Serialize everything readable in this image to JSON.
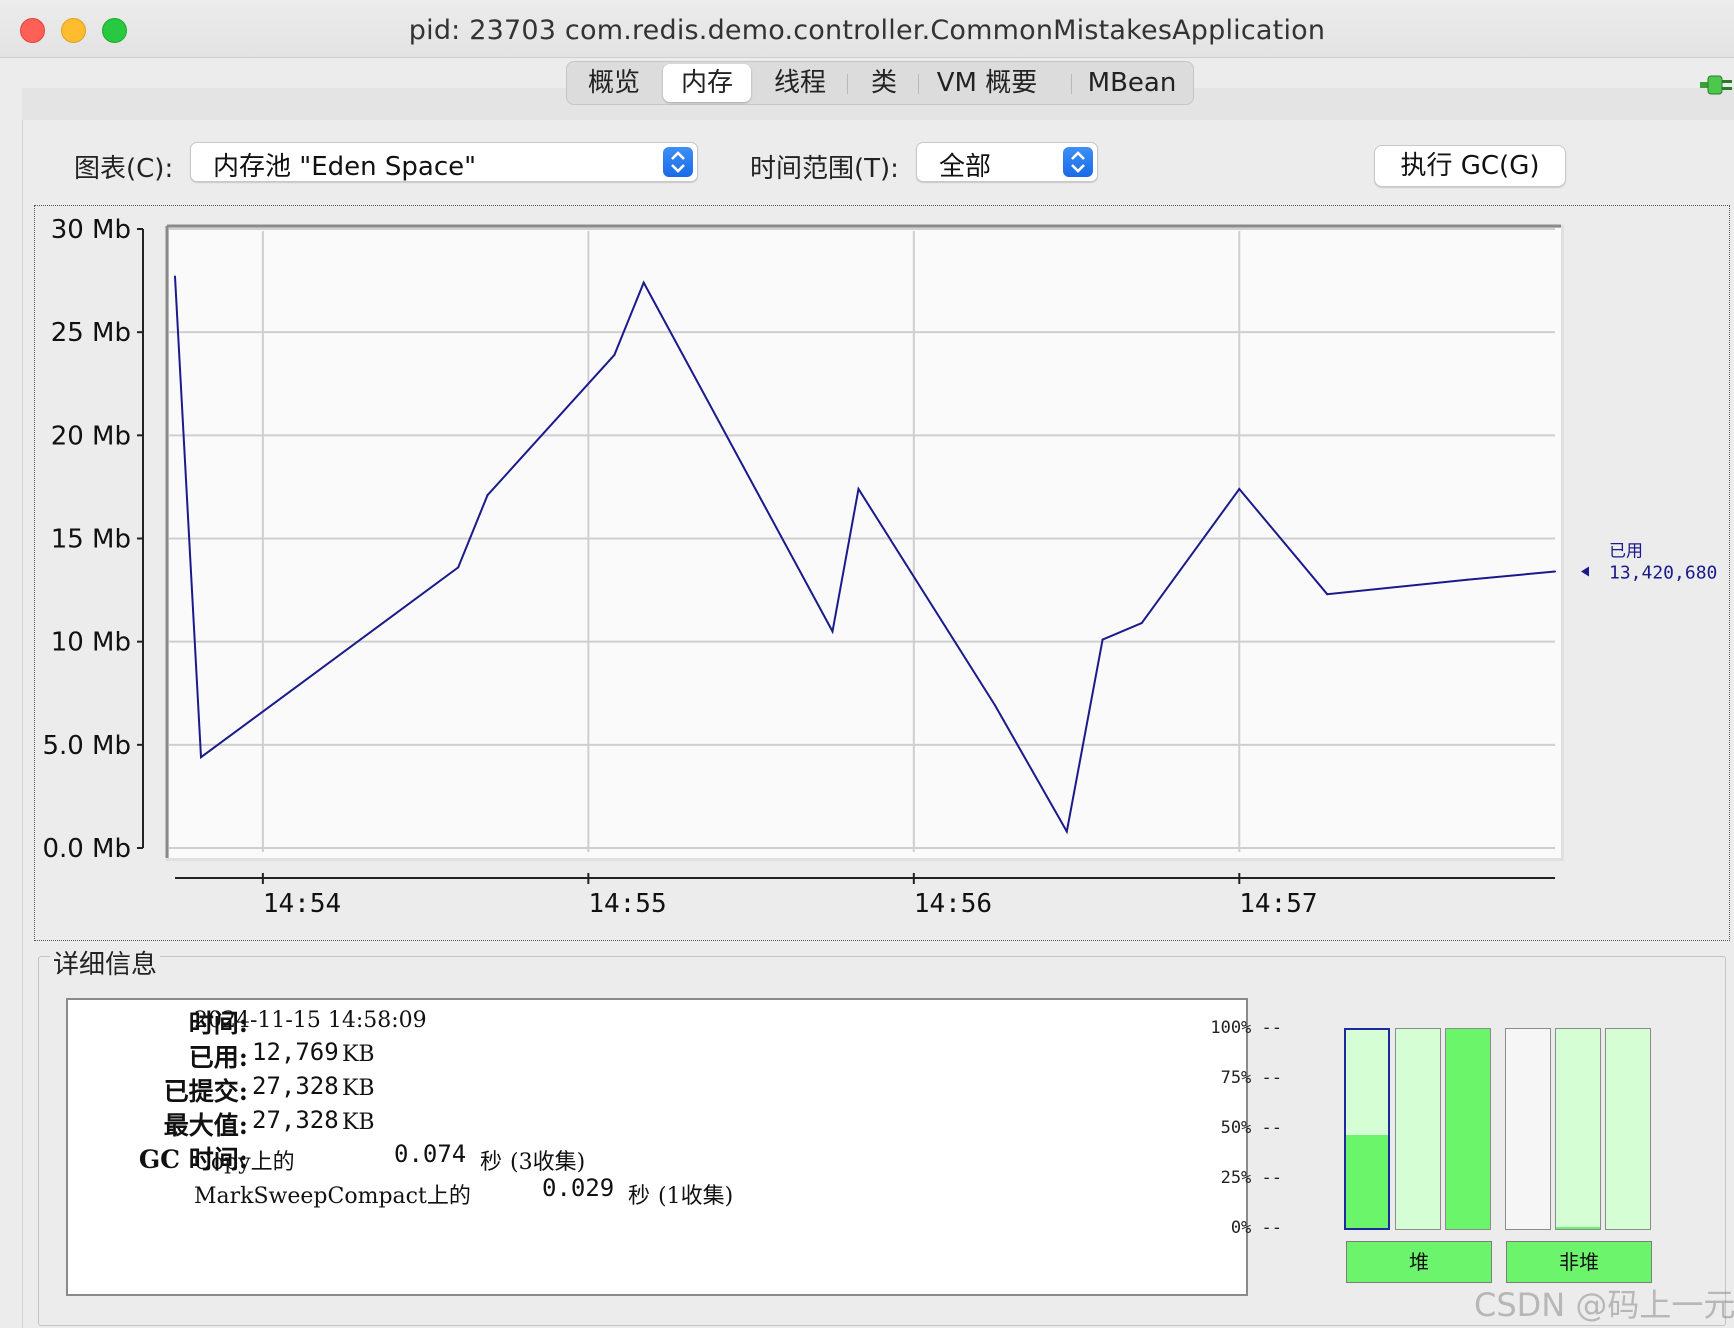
{
  "window": {
    "title": "pid: 23703 com.redis.demo.controller.CommonMistakesApplication"
  },
  "tabs": [
    {
      "label": "概览",
      "active": false
    },
    {
      "label": "内存",
      "active": true
    },
    {
      "label": "线程",
      "active": false
    },
    {
      "label": "类",
      "active": false
    },
    {
      "label": "VM 概要",
      "active": false
    },
    {
      "label": "MBean",
      "active": false
    }
  ],
  "controls": {
    "chart_label": "图表(C):",
    "chart_value": "内存池 \"Eden Space\"",
    "range_label": "时间范围(T):",
    "range_value": "全部",
    "gc_button": "执行 GC(G)"
  },
  "chart_data": {
    "type": "line",
    "title": "",
    "xlabel": "",
    "ylabel": "",
    "y_unit": "Mb",
    "ylim": [
      0,
      30
    ],
    "y_ticks": [
      "0.0 Mb",
      "5.0 Mb",
      "10 Mb",
      "15 Mb",
      "20 Mb",
      "25 Mb",
      "30 Mb"
    ],
    "x_ticks": [
      "14:54",
      "14:55",
      "14:56",
      "14:57"
    ],
    "xlim_minutes": [
      53.73,
      57.97
    ],
    "grid": true,
    "legend_position": "right",
    "series": [
      {
        "name": "已用",
        "color": "#1a1a8c",
        "last_value": "13,420,680",
        "x_minutes": [
          53.73,
          53.81,
          54.6,
          54.69,
          55.08,
          55.17,
          55.75,
          55.83,
          56.25,
          56.47,
          56.58,
          56.7,
          57.0,
          57.27,
          57.7,
          57.97
        ],
        "y_mb": [
          27.7,
          4.4,
          13.6,
          17.1,
          23.9,
          27.4,
          10.5,
          17.4,
          6.9,
          0.8,
          10.1,
          10.9,
          17.4,
          12.3,
          13.0,
          13.4
        ]
      }
    ]
  },
  "details": {
    "section_title": "详细信息",
    "time_label": "时间:",
    "time_value": "2024-11-15 14:58:09",
    "used_label": "已用:",
    "used_value": "12,769",
    "used_unit": "KB",
    "committed_label": "已提交:",
    "committed_value": "27,328",
    "committed_unit": "KB",
    "max_label": "最大值:",
    "max_value": "27,328",
    "max_unit": "KB",
    "gc_label": "GC 时间:",
    "gc_rows": [
      {
        "collector": "Copy上的",
        "time": "0.074",
        "unit": "秒",
        "count": "(3收集)"
      },
      {
        "collector": "MarkSweepCompact上的",
        "time": "0.029",
        "unit": "秒",
        "count": "(1收集)"
      }
    ]
  },
  "pools": {
    "axis_labels": [
      "100% --",
      "75% --",
      "50% --",
      "25% --",
      "0% --"
    ],
    "heap_button": "堆",
    "nonheap_button": "非堆",
    "bars": [
      {
        "group": "heap",
        "fill_fraction": 0.47,
        "selected": true,
        "empty": false
      },
      {
        "group": "heap",
        "fill_fraction": 0.0,
        "selected": false,
        "empty": false
      },
      {
        "group": "heap",
        "fill_fraction": 1.0,
        "selected": false,
        "empty": false
      },
      {
        "group": "nonheap",
        "fill_fraction": 0.0,
        "selected": false,
        "empty": true
      },
      {
        "group": "nonheap",
        "fill_fraction": 0.01,
        "selected": false,
        "empty": false
      },
      {
        "group": "nonheap",
        "fill_fraction": 0.0,
        "selected": false,
        "empty": false
      }
    ]
  },
  "watermark": "CSDN @码上一元"
}
